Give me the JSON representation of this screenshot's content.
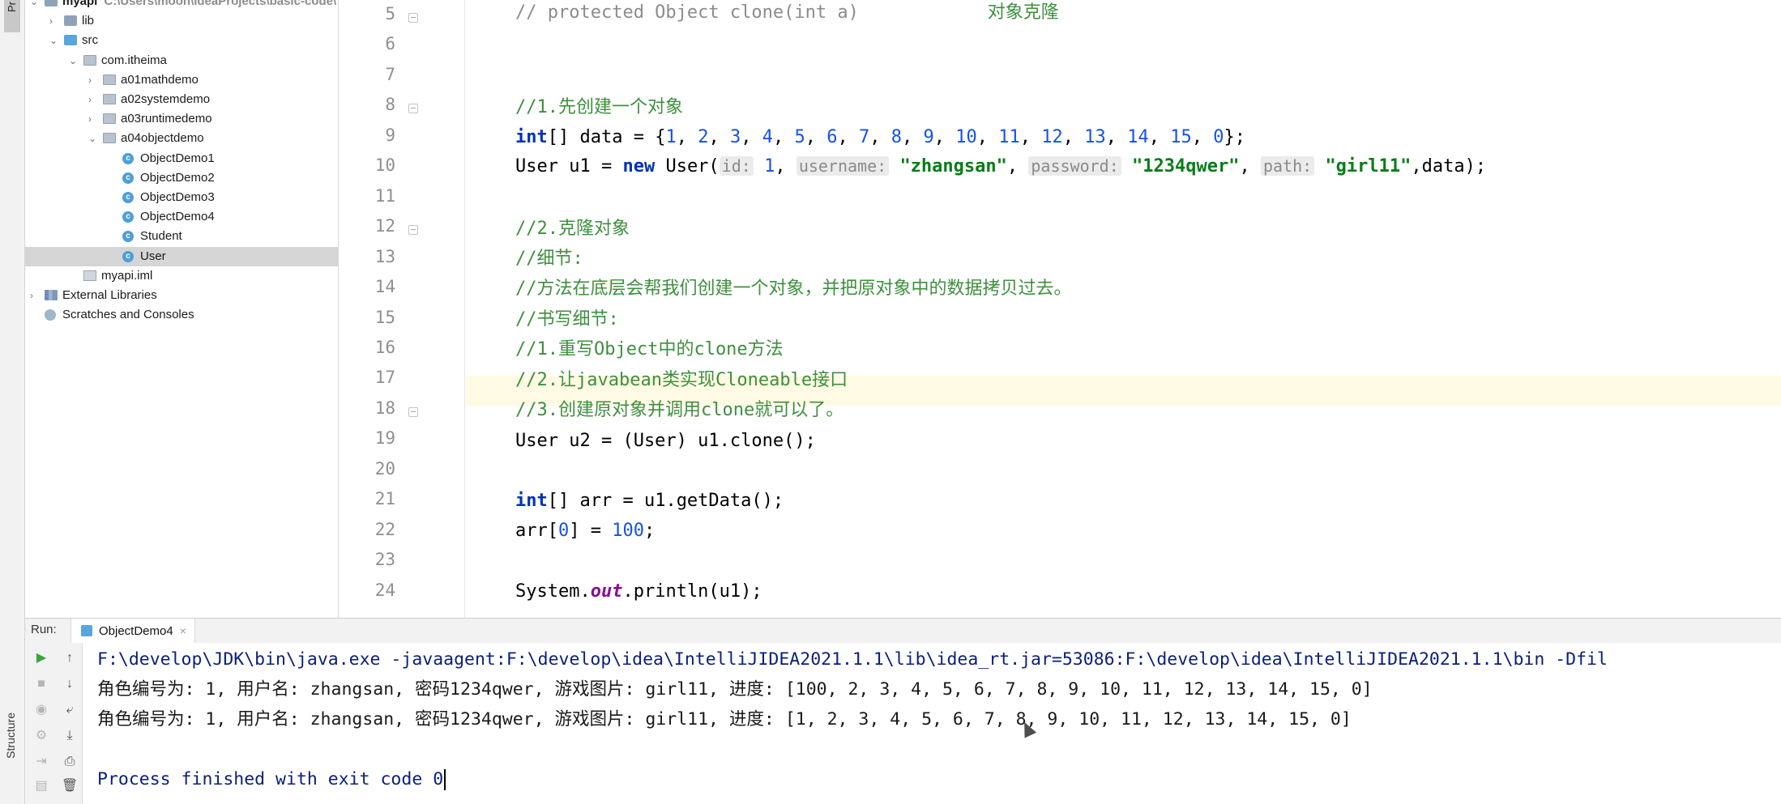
{
  "side_tabs": {
    "project": "Pr",
    "structure": "Structure"
  },
  "project_tree": [
    {
      "name": "myapi",
      "path": "C:\\Users\\moon\\IdeaProjects\\basic-code\\",
      "icon": "module-folder-icon",
      "arrow": "⌄",
      "level": 0
    },
    {
      "name": "lib",
      "icon": "folder-icon",
      "arrow": "›",
      "level": 1
    },
    {
      "name": "src",
      "icon": "source-folder-icon",
      "arrow": "⌄",
      "level": 1
    },
    {
      "name": "com.itheima",
      "icon": "package-icon",
      "arrow": "⌄",
      "level": 2
    },
    {
      "name": "a01mathdemo",
      "icon": "package-icon",
      "arrow": "›",
      "level": 3
    },
    {
      "name": "a02systemdemo",
      "icon": "package-icon",
      "arrow": "›",
      "level": 3
    },
    {
      "name": "a03runtimedemo",
      "icon": "package-icon",
      "arrow": "›",
      "level": 3
    },
    {
      "name": "a04objectdemo",
      "icon": "package-icon",
      "arrow": "⌄",
      "level": 3
    },
    {
      "name": "ObjectDemo1",
      "icon": "class-icon",
      "level": 4
    },
    {
      "name": "ObjectDemo2",
      "icon": "class-icon",
      "level": 4
    },
    {
      "name": "ObjectDemo3",
      "icon": "class-icon",
      "level": 4
    },
    {
      "name": "ObjectDemo4",
      "icon": "class-icon",
      "level": 4
    },
    {
      "name": "Student",
      "icon": "class-icon",
      "level": 4
    },
    {
      "name": "User",
      "icon": "class-icon",
      "level": 4,
      "selected": true
    },
    {
      "name": "myapi.iml",
      "icon": "iml-file-icon",
      "level": 2
    },
    {
      "name": "External Libraries",
      "icon": "library-icon",
      "arrow": "›",
      "level": 0
    },
    {
      "name": "Scratches and Consoles",
      "icon": "scratch-icon",
      "level": 0
    }
  ],
  "editor": {
    "line_numbers": [
      "5",
      "6",
      "7",
      "8",
      "9",
      "10",
      "11",
      "12",
      "13",
      "14",
      "15",
      "16",
      "17",
      "18",
      "19",
      "20",
      "21",
      "22",
      "23",
      "24"
    ],
    "lines": {
      "l5_comment": "// protected Object clone(int a)",
      "l5_cn": "对象克隆",
      "l8": "//1.先创建一个对象",
      "l9_kw": "int",
      "l9_a": "[] data = {",
      "l9_nums": [
        "1",
        "2",
        "3",
        "4",
        "5",
        "6",
        "7",
        "8",
        "9",
        "10",
        "11",
        "12",
        "13",
        "14",
        "15",
        "0"
      ],
      "l9_sep": ", ",
      "l9_b": "};",
      "l10_a": "User u1 = ",
      "l10_kw": "new",
      "l10_b": " User(",
      "l10_hint_id": "id:",
      "l10_num": "1",
      "l10_c": ",",
      "l10_hint_username": "username:",
      "l10_str1": "\"zhangsan\"",
      "l10_hint_password": "password:",
      "l10_str2": "\"1234qwer\"",
      "l10_hint_path": "path:",
      "l10_str3": "\"girl11\"",
      "l10_d": ",data);",
      "l12": "//2.克隆对象",
      "l13": "//细节:",
      "l14": "//方法在底层会帮我们创建一个对象，并把原对象中的数据拷贝过去。",
      "l15": "//书写细节:",
      "l16": "//1.重写Object中的clone方法",
      "l17": "//2.让javabean类实现Cloneable接口",
      "l18": "//3.创建原对象并调用clone就可以了。",
      "l19": "User u2 = (User) u1.clone();",
      "l21_kw": "int",
      "l21_a": "[] arr = u1.getData();",
      "l22_a": "arr[",
      "l22_n0": "0",
      "l22_b": "] = ",
      "l22_n1": "100",
      "l22_c": ";",
      "l24_a": "System.",
      "l24_field": "out",
      "l24_b": ".println(u1);"
    }
  },
  "run_panel": {
    "label": "Run:",
    "tab": "ObjectDemo4",
    "close_glyph": "×",
    "output": {
      "cmd": "F:\\develop\\JDK\\bin\\java.exe -javaagent:F:\\develop\\idea\\IntelliJIDEA2021.1.1\\lib\\idea_rt.jar=53086:F:\\develop\\idea\\IntelliJIDEA2021.1.1\\bin -Dfil",
      "line1": "角色编号为: 1, 用户名: zhangsan, 密码1234qwer, 游戏图片: girl11, 进度: [100, 2, 3, 4, 5, 6, 7, 8, 9, 10, 11, 12, 13, 14, 15, 0]",
      "line2": "角色编号为: 1, 用户名: zhangsan, 密码1234qwer, 游戏图片: girl11, 进度: [1, 2, 3, 4, 5, 6, 7, 8, 9, 10, 11, 12, 13, 14, 15, 0]",
      "exit": "Process finished with exit code 0"
    }
  },
  "colors": {
    "keyword": "#0033b3",
    "number": "#1750eb",
    "string": "#067d17",
    "comment_cn": "#3f8f3f",
    "current_line": "#fffae3",
    "selection": "#d5d5d5"
  }
}
